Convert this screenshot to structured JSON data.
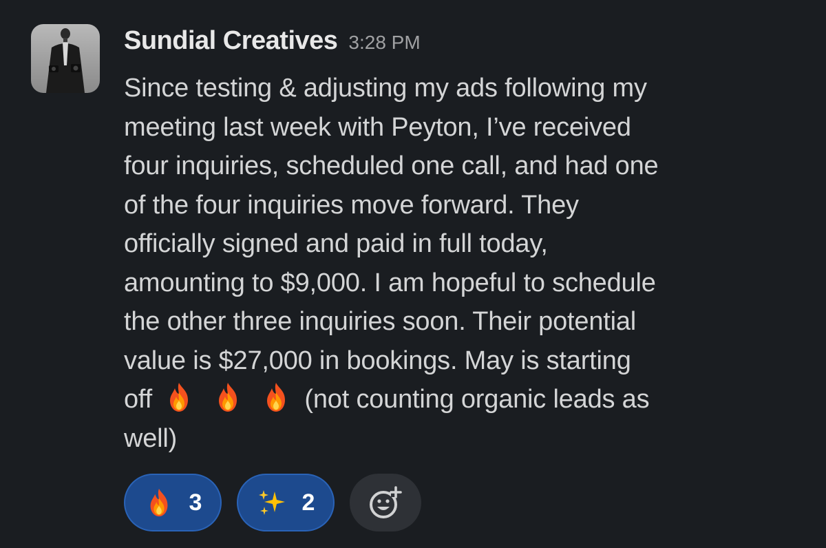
{
  "message": {
    "sender": "Sundial Creatives",
    "timestamp": "3:28 PM",
    "avatar_icon": "person-photo-avatar",
    "lines": [
      "Since testing & adjusting my ads following my",
      "meeting last week with Peyton, I’ve received",
      "four inquiries, scheduled one call, and had one",
      "of the four inquiries move forward. They",
      "officially signed and paid in full today,",
      "amounting to $9,000. I am hopeful to schedule",
      "the other three inquiries soon. Their potential",
      "value is $27,000 in bookings. May is starting"
    ],
    "line_with_emoji_prefix": "off",
    "line_with_emoji_suffix": "(not counting organic leads as",
    "inline_emojis": [
      "fire-emoji",
      "fire-emoji",
      "fire-emoji"
    ],
    "last_line": "well)"
  },
  "reactions": [
    {
      "emoji": "fire-emoji",
      "count": "3"
    },
    {
      "emoji": "sparkles-emoji",
      "count": "2"
    }
  ],
  "add_reaction_icon": "add-reaction-icon",
  "colors": {
    "background": "#1a1d21",
    "reaction_bg": "#1d4a8e",
    "reaction_border": "#2a63b7",
    "add_reaction_bg": "#2e3136"
  }
}
